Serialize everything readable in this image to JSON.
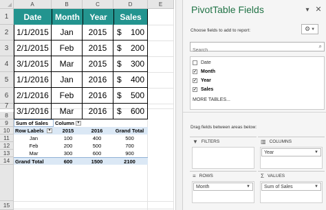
{
  "sheet": {
    "columns": [
      "A",
      "B",
      "C",
      "D",
      "E"
    ],
    "rows_top": [
      "1",
      "2",
      "3",
      "4",
      "5",
      "6",
      "7"
    ],
    "rows_bottom": [
      "8",
      "9",
      "10",
      "11",
      "12",
      "13",
      "14",
      "15"
    ],
    "table": {
      "headers": [
        "Date",
        "Month",
        "Year",
        "Sales"
      ],
      "rows": [
        {
          "date": "1/1/2015",
          "month": "Jan",
          "year": "2015",
          "currency": "$",
          "sales": "100"
        },
        {
          "date": "2/1/2015",
          "month": "Feb",
          "year": "2015",
          "currency": "$",
          "sales": "200"
        },
        {
          "date": "3/1/2015",
          "month": "Mar",
          "year": "2015",
          "currency": "$",
          "sales": "300"
        },
        {
          "date": "1/1/2016",
          "month": "Jan",
          "year": "2016",
          "currency": "$",
          "sales": "400"
        },
        {
          "date": "2/1/2016",
          "month": "Feb",
          "year": "2016",
          "currency": "$",
          "sales": "500"
        },
        {
          "date": "3/1/2016",
          "month": "Mar",
          "year": "2016",
          "currency": "$",
          "sales": "600"
        }
      ]
    },
    "pivot": {
      "value_label": "Sum of Sales",
      "column_labels": "Column L",
      "row_labels": "Row Labels",
      "year_headers": [
        "2015",
        "2016",
        "Grand Total"
      ],
      "rows": [
        {
          "label": "Jan",
          "values": [
            "100",
            "400",
            "500"
          ]
        },
        {
          "label": "Feb",
          "values": [
            "200",
            "500",
            "700"
          ]
        },
        {
          "label": "Mar",
          "values": [
            "300",
            "600",
            "900"
          ]
        }
      ],
      "grand_total": {
        "label": "Grand Total",
        "values": [
          "600",
          "1500",
          "2100"
        ]
      }
    }
  },
  "panel": {
    "title": "PivotTable Fields",
    "subtitle": "Choose fields to add to report:",
    "search_placeholder": "Search",
    "fields": [
      {
        "label": "Date",
        "checked": false
      },
      {
        "label": "Month",
        "checked": true
      },
      {
        "label": "Year",
        "checked": true
      },
      {
        "label": "Sales",
        "checked": true
      }
    ],
    "more_tables": "MORE TABLES...",
    "drag_label": "Drag fields between areas below:",
    "areas": {
      "filters": {
        "label": "FILTERS"
      },
      "columns": {
        "label": "COLUMNS",
        "item": "Year"
      },
      "rows": {
        "label": "ROWS",
        "item": "Month"
      },
      "values": {
        "label": "VALUES",
        "item": "Sum of Sales"
      }
    },
    "icons": {
      "close": "close-icon",
      "dropdown": "chevron-down-icon",
      "gear": "gear-icon",
      "search": "search-icon"
    },
    "accent_color": "#217346",
    "table_header_color": "#23948f",
    "pivot_band_color": "#dbe8f5"
  }
}
